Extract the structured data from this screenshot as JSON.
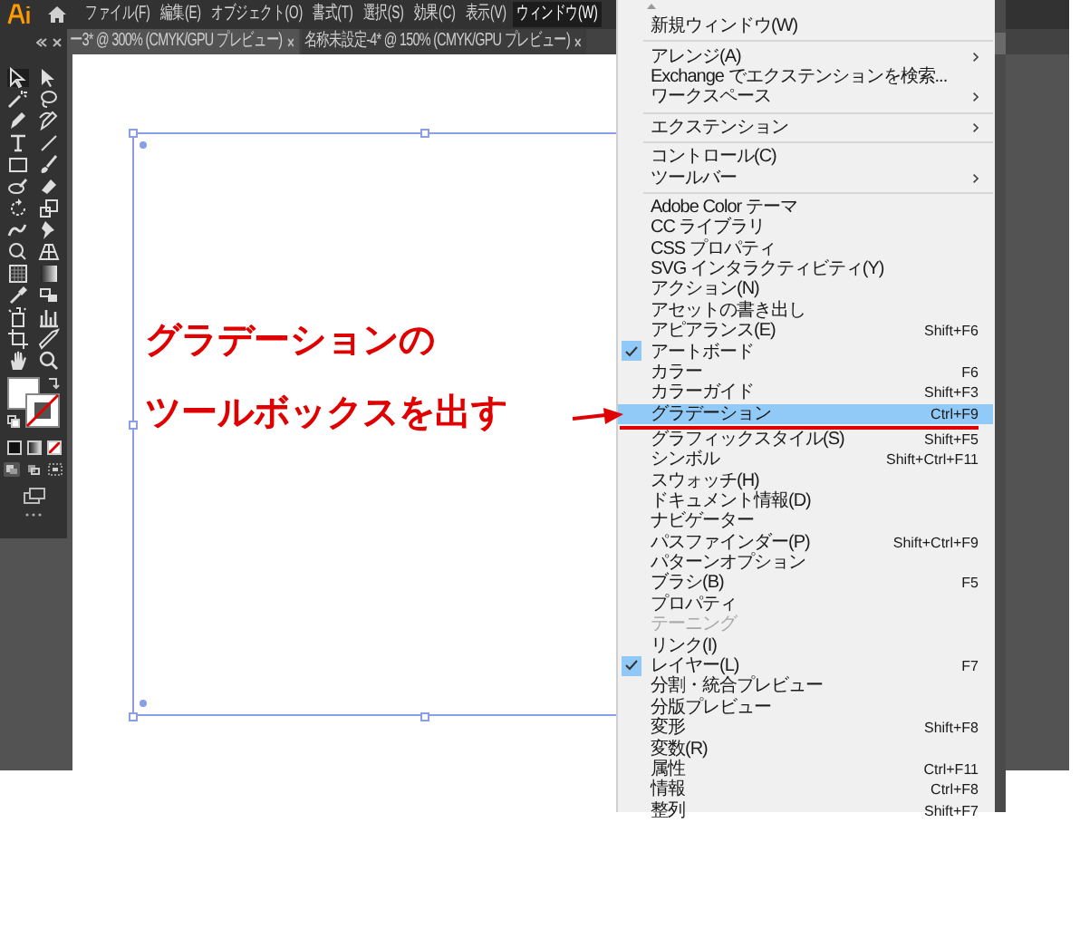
{
  "menu_bar": {
    "items": [
      {
        "label": "ファイル(F)",
        "selected": false
      },
      {
        "label": "編集(E)",
        "selected": false
      },
      {
        "label": "オブジェクト(O)",
        "selected": false
      },
      {
        "label": "書式(T)",
        "selected": false
      },
      {
        "label": "選択(S)",
        "selected": false
      },
      {
        "label": "効果(C)",
        "selected": false
      },
      {
        "label": "表示(V)",
        "selected": false
      },
      {
        "label": "ウィンドウ(W)",
        "selected": true
      }
    ]
  },
  "document_tabs": [
    {
      "label": "ー3* @ 300% (CMYK/GPU プレビュー)",
      "selected": true
    },
    {
      "label": "名称未設定-4* @ 150% (CMYK/GPU プレビュー)",
      "selected": false
    }
  ],
  "annotation": {
    "lines": [
      "グラデーションの",
      "ツールボックスを出す"
    ]
  },
  "window_menu": {
    "groups": [
      {
        "items": [
          {
            "label": "新規ウィンドウ(W)",
            "submenu": false,
            "checked": false,
            "disabled": false,
            "selected": false
          }
        ]
      },
      {
        "items": [
          {
            "label": "アレンジ(A)",
            "submenu": true,
            "checked": false,
            "disabled": false,
            "selected": false
          },
          {
            "label": "Exchange でエクステンションを検索...",
            "submenu": false,
            "checked": false,
            "disabled": false,
            "selected": false
          },
          {
            "label": "ワークスペース",
            "submenu": true,
            "checked": false,
            "disabled": false,
            "selected": false
          }
        ]
      },
      {
        "items": [
          {
            "label": "エクステンション",
            "submenu": true,
            "checked": false,
            "disabled": false,
            "selected": false
          }
        ]
      },
      {
        "items": [
          {
            "label": "コントロール(C)",
            "submenu": false,
            "checked": false,
            "disabled": false,
            "selected": false
          },
          {
            "label": "ツールバー",
            "submenu": true,
            "checked": false,
            "disabled": false,
            "selected": false
          }
        ]
      },
      {
        "items": [
          {
            "label": "Adobe Color テーマ",
            "submenu": false,
            "checked": false,
            "disabled": false,
            "selected": false
          },
          {
            "label": "CC ライブラリ",
            "submenu": false,
            "checked": false,
            "disabled": false,
            "selected": false
          },
          {
            "label": "CSS プロパティ",
            "submenu": false,
            "checked": false,
            "disabled": false,
            "selected": false
          },
          {
            "label": "SVG インタラクティビティ(Y)",
            "submenu": false,
            "checked": false,
            "disabled": false,
            "selected": false
          },
          {
            "label": "アクション(N)",
            "submenu": false,
            "checked": false,
            "disabled": false,
            "selected": false
          },
          {
            "label": "アセットの書き出し",
            "submenu": false,
            "checked": false,
            "disabled": false,
            "selected": false
          },
          {
            "label": "アピアランス(E)",
            "shortcut": "Shift+F6",
            "submenu": false,
            "checked": false,
            "disabled": false,
            "selected": false
          },
          {
            "label": "アートボード",
            "submenu": false,
            "checked": true,
            "disabled": false,
            "selected": false
          },
          {
            "label": "カラー",
            "shortcut": "F6",
            "submenu": false,
            "checked": false,
            "disabled": false,
            "selected": false
          },
          {
            "label": "カラーガイド",
            "shortcut": "Shift+F3",
            "submenu": false,
            "checked": false,
            "disabled": false,
            "selected": false
          },
          {
            "label": "グラデーション",
            "shortcut": "Ctrl+F9",
            "submenu": false,
            "checked": false,
            "disabled": false,
            "selected": true
          },
          {
            "label": "グラフィックスタイル(S)",
            "shortcut": "Shift+F5",
            "submenu": false,
            "checked": false,
            "disabled": false,
            "selected": false
          },
          {
            "label": "シンボル",
            "shortcut": "Shift+Ctrl+F11",
            "submenu": false,
            "checked": false,
            "disabled": false,
            "selected": false
          },
          {
            "label": "スウォッチ(H)",
            "submenu": false,
            "checked": false,
            "disabled": false,
            "selected": false
          },
          {
            "label": "ドキュメント情報(D)",
            "submenu": false,
            "checked": false,
            "disabled": false,
            "selected": false
          },
          {
            "label": "ナビゲーター",
            "submenu": false,
            "checked": false,
            "disabled": false,
            "selected": false
          },
          {
            "label": "パスファインダー(P)",
            "shortcut": "Shift+Ctrl+F9",
            "submenu": false,
            "checked": false,
            "disabled": false,
            "selected": false
          },
          {
            "label": "パターンオプション",
            "submenu": false,
            "checked": false,
            "disabled": false,
            "selected": false
          },
          {
            "label": "ブラシ(B)",
            "shortcut": "F5",
            "submenu": false,
            "checked": false,
            "disabled": false,
            "selected": false
          },
          {
            "label": "プロパティ",
            "submenu": false,
            "checked": false,
            "disabled": false,
            "selected": false
          },
          {
            "label": "テーニング",
            "submenu": false,
            "checked": false,
            "disabled": true,
            "selected": false
          },
          {
            "label": "リンク(I)",
            "submenu": false,
            "checked": false,
            "disabled": false,
            "selected": false
          },
          {
            "label": "レイヤー(L)",
            "shortcut": "F7",
            "submenu": false,
            "checked": true,
            "disabled": false,
            "selected": false
          },
          {
            "label": "分割・統合プレビュー",
            "submenu": false,
            "checked": false,
            "disabled": false,
            "selected": false
          },
          {
            "label": "分版プレビュー",
            "submenu": false,
            "checked": false,
            "disabled": false,
            "selected": false
          },
          {
            "label": "変形",
            "shortcut": "Shift+F8",
            "submenu": false,
            "checked": false,
            "disabled": false,
            "selected": false
          },
          {
            "label": "変数(R)",
            "submenu": false,
            "checked": false,
            "disabled": false,
            "selected": false
          },
          {
            "label": "属性",
            "shortcut": "Ctrl+F11",
            "submenu": false,
            "checked": false,
            "disabled": false,
            "selected": false
          },
          {
            "label": "情報",
            "shortcut": "Ctrl+F8",
            "submenu": false,
            "checked": false,
            "disabled": false,
            "selected": false
          },
          {
            "label": "整列",
            "shortcut": "Shift+F7",
            "submenu": false,
            "checked": false,
            "disabled": false,
            "selected": false
          }
        ]
      }
    ]
  }
}
